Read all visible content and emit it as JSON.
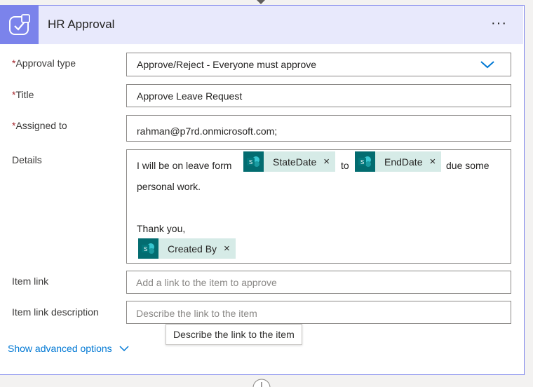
{
  "card": {
    "title": "HR Approval",
    "more_label": "···",
    "header_icon": "approval-check-icon"
  },
  "fields": {
    "approval_type": {
      "label": "Approval type",
      "required": "*",
      "value": "Approve/Reject - Everyone must approve"
    },
    "title": {
      "label": "Title",
      "required": "*",
      "value": "Approve Leave Request"
    },
    "assigned_to": {
      "label": "Assigned to",
      "required": "*",
      "value": "rahman@p7rd.onmicrosoft.com;"
    },
    "details": {
      "label": "Details",
      "text_1": "I will be on leave form",
      "token_1": "StateDate",
      "text_2": "to",
      "token_2": "EndDate",
      "text_3": "due some",
      "text_4": "personal work.",
      "text_5": "Thank you,",
      "token_3": "Created By"
    },
    "item_link": {
      "label": "Item link",
      "placeholder": "Add a link to the item to approve"
    },
    "item_link_description": {
      "label": "Item link description",
      "placeholder": "Describe the link to the item"
    }
  },
  "tooltip": "Describe the link to the item",
  "advanced": "Show advanced options",
  "token_remove": "×",
  "colors": {
    "accent": "#7b83eb",
    "header_bg": "#e8e9fc",
    "token_bg": "#d6ebe7",
    "sharepoint": "#036c70",
    "link": "#0078d4"
  }
}
